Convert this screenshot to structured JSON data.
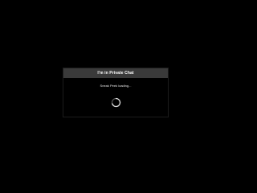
{
  "modal": {
    "title": "I'm in Private Chat",
    "status_text": "Sneak Peek loading...",
    "spinner_icon": "loading-spinner-icon"
  },
  "colors": {
    "background": "#000000",
    "header_bg": "#3a3a3a",
    "text": "#ffffff"
  }
}
